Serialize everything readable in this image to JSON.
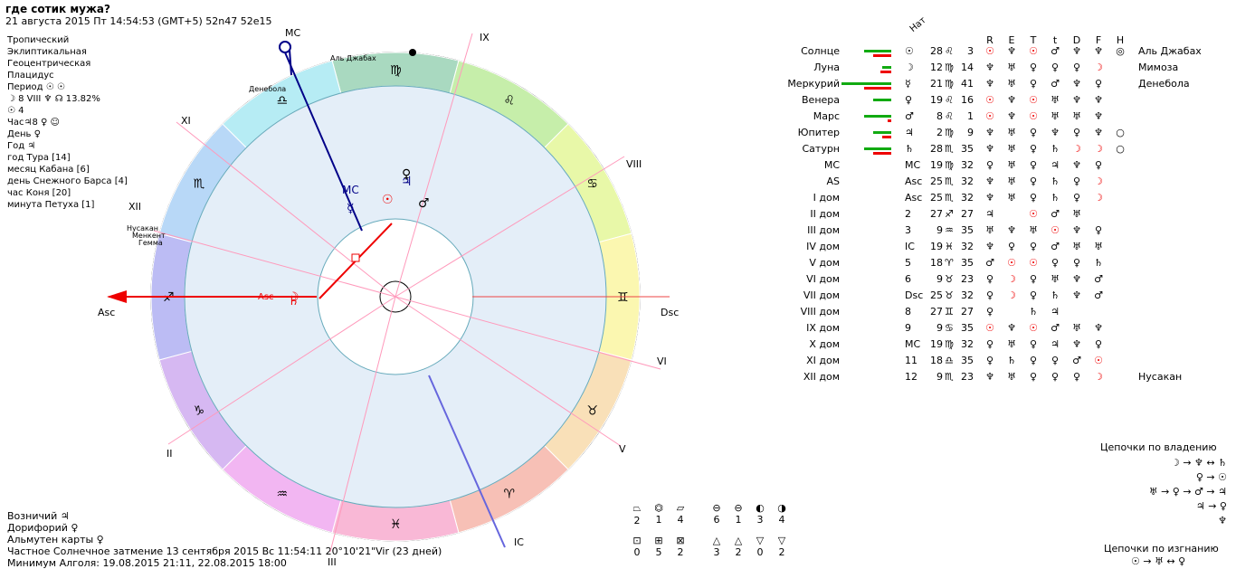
{
  "header": {
    "title": "где сотик мужа?",
    "subtitle": "21 августа 2015  Пт  14:54:53 (GMT+5) 52n47  52e15"
  },
  "left_info": [
    "Тропический",
    "Эклиптикальная",
    "Геоцентрическая",
    "Плацидус",
    "Период  ☉ ☉",
    "☽  8 VIII  ♆ ☊ 13.82%",
    "☉  4",
    "Час♃8 ♀ ☺",
    "День ♀",
    "Год ♃",
    "год Тура [14]",
    "месяц Кабана [6]",
    "день Снежного Барса [4]",
    "час Коня [20]",
    "минута Петуха [1]"
  ],
  "bottom_info": [
    "Возничий  ♃",
    "Дорифорий  ♀",
    "Альмутен карты  ♀",
    "Частное Солнечное затмение 13 сентября 2015 Вс 11:54:11 20°10'21\"Vir (23 дней)",
    "Минимум Алголя: 19.08.2015 21:11,  22.08.2015 18:00"
  ],
  "chart_labels": {
    "mc": "MC",
    "asc": "Asc",
    "dsc": "Dsc",
    "ic": "IC",
    "houses": [
      "IX",
      "VIII",
      "VI",
      "V",
      "III",
      "II",
      "XI",
      "XII"
    ],
    "stars": [
      "Аль Джабах",
      "Денебола",
      "Нусакан",
      "Менкент",
      "Гемма"
    ]
  },
  "table": {
    "header_nat": "Нат",
    "col_headers": [
      "R",
      "E",
      "T",
      "t",
      "D",
      "F",
      "H"
    ],
    "rows": [
      {
        "name": "Солнце",
        "sym": "☉",
        "pos": "28",
        "sign": "♌",
        "min": "3",
        "cells": [
          "☉",
          "♆",
          "☉",
          "♂",
          "♆",
          "♆"
        ],
        "extra": "◎",
        "star": "Аль Джабах"
      },
      {
        "name": "Луна",
        "sym": "☽",
        "pos": "12",
        "sign": "♍",
        "min": "14",
        "cells": [
          "♆",
          "♅",
          "♀",
          "♀",
          "♀",
          "☽"
        ],
        "extra": "",
        "star": "Мимоза"
      },
      {
        "name": "Меркурий",
        "sym": "☿",
        "pos": "21",
        "sign": "♍",
        "min": "41",
        "cells": [
          "♆",
          "♅",
          "♀",
          "♂",
          "♆",
          "♀"
        ],
        "extra": "",
        "star": "Денебола"
      },
      {
        "name": "Венера",
        "sym": "♀",
        "pos": "19",
        "sign": "♌",
        "min": "16",
        "cells": [
          "☉",
          "♆",
          "☉",
          "♅",
          "♆",
          "♆"
        ],
        "extra": "",
        "star": ""
      },
      {
        "name": "Марс",
        "sym": "♂",
        "pos": "8",
        "sign": "♌",
        "min": "1",
        "cells": [
          "☉",
          "♆",
          "☉",
          "♅",
          "♅",
          "♆"
        ],
        "extra": "",
        "star": ""
      },
      {
        "name": "Юпитер",
        "sym": "♃",
        "pos": "2",
        "sign": "♍",
        "min": "9",
        "cells": [
          "♆",
          "♅",
          "♀",
          "♆",
          "♀",
          "♆"
        ],
        "extra": "○",
        "star": ""
      },
      {
        "name": "Сатурн",
        "sym": "♄",
        "pos": "28",
        "sign": "♏",
        "min": "35",
        "cells": [
          "♆",
          "♅",
          "♀",
          "♄",
          "☽",
          "☽"
        ],
        "extra": "○",
        "star": ""
      },
      {
        "name": "MC",
        "sym": "MC",
        "pos": "19",
        "sign": "♍",
        "min": "32",
        "cells": [
          "♀",
          "♅",
          "♀",
          "♃",
          "♆",
          "♀"
        ],
        "extra": "",
        "star": ""
      },
      {
        "name": "AS",
        "sym": "Asc",
        "pos": "25",
        "sign": "♏",
        "min": "32",
        "cells": [
          "♆",
          "♅",
          "♀",
          "♄",
          "♀",
          "☽"
        ],
        "extra": "",
        "star": ""
      },
      {
        "name": "I дом",
        "sym": "Asc",
        "pos": "25",
        "sign": "♏",
        "min": "32",
        "cells": [
          "♆",
          "♅",
          "♀",
          "♄",
          "♀",
          "☽"
        ],
        "extra": "",
        "star": ""
      },
      {
        "name": "II дом",
        "sym": "2",
        "pos": "27",
        "sign": "♐",
        "min": "27",
        "cells": [
          "♃",
          "",
          "☉",
          "♂",
          "♅",
          "",
          ""
        ],
        "extra": "",
        "star": ""
      },
      {
        "name": "III дом",
        "sym": "3",
        "pos": "9",
        "sign": "♒",
        "min": "35",
        "cells": [
          "♅",
          "♆",
          "♅",
          "☉",
          "♆",
          "♀"
        ],
        "extra": "",
        "star": ""
      },
      {
        "name": "IV дом",
        "sym": "IC",
        "pos": "19",
        "sign": "♓",
        "min": "32",
        "cells": [
          "♆",
          "♀",
          "♀",
          "♂",
          "♅",
          "♅"
        ],
        "extra": "",
        "star": ""
      },
      {
        "name": "V дом",
        "sym": "5",
        "pos": "18",
        "sign": "♈",
        "min": "35",
        "cells": [
          "♂",
          "☉",
          "☉",
          "♀",
          "♀",
          "♄"
        ],
        "extra": "",
        "star": ""
      },
      {
        "name": "VI дом",
        "sym": "6",
        "pos": "9",
        "sign": "♉",
        "min": "23",
        "cells": [
          "♀",
          "☽",
          "♀",
          "♅",
          "♆",
          "♂"
        ],
        "extra": "",
        "star": ""
      },
      {
        "name": "VII дом",
        "sym": "Dsc",
        "pos": "25",
        "sign": "♉",
        "min": "32",
        "cells": [
          "♀",
          "☽",
          "♀",
          "♄",
          "♆",
          "♂"
        ],
        "extra": "",
        "star": ""
      },
      {
        "name": "VIII дом",
        "sym": "8",
        "pos": "27",
        "sign": "♊",
        "min": "27",
        "cells": [
          "♀",
          "",
          "♄",
          "♃",
          "",
          ""
        ],
        "extra": "",
        "star": ""
      },
      {
        "name": "IX дом",
        "sym": "9",
        "pos": "9",
        "sign": "♋",
        "min": "35",
        "cells": [
          "☉",
          "♆",
          "☉",
          "♂",
          "♅",
          "♆"
        ],
        "extra": "",
        "star": ""
      },
      {
        "name": "X дом",
        "sym": "MC",
        "pos": "19",
        "sign": "♍",
        "min": "32",
        "cells": [
          "♀",
          "♅",
          "♀",
          "♃",
          "♆",
          "♀"
        ],
        "extra": "",
        "star": ""
      },
      {
        "name": "XI дом",
        "sym": "11",
        "pos": "18",
        "sign": "♎",
        "min": "35",
        "cells": [
          "♀",
          "♄",
          "♀",
          "♀",
          "♂",
          "☉"
        ],
        "extra": "",
        "star": ""
      },
      {
        "name": "XII дом",
        "sym": "12",
        "pos": "9",
        "sign": "♏",
        "min": "23",
        "cells": [
          "♆",
          "♅",
          "♀",
          "♀",
          "♀",
          "☽"
        ],
        "extra": "",
        "star": "Нусакан"
      }
    ]
  },
  "bottom_stats": {
    "row1_vals": [
      "2",
      "1",
      "4",
      "6",
      "1",
      "3",
      "4"
    ],
    "row2_vals": [
      "0",
      "5",
      "2",
      "3",
      "2",
      "0",
      "2"
    ]
  },
  "chains": {
    "ownership_title": "Цепочки по владению",
    "ownership": [
      "☽ → ♆ ↔ ♄",
      "♀ → ☉",
      "♅ → ♀ → ♂ → ♃",
      "♃ → ♀",
      "♆"
    ],
    "exile_title": "Цепочки по изгнанию",
    "exile": [
      "☉ → ♅ ↔ ♀"
    ]
  }
}
